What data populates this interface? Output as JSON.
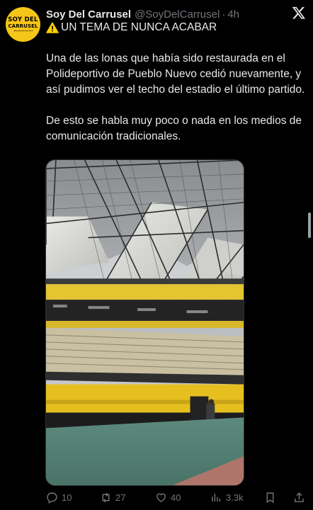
{
  "tweet": {
    "author_name": "Soy Del Carrusel",
    "author_handle": "@SoyDelCarrusel",
    "separator": "·",
    "time": "4h",
    "avatar_text_line1": "SOY DEL",
    "avatar_text_line2": "CARRUSEL",
    "title": "UN TEMA DE NUNCA ACABAR",
    "paragraphs": [
      "Una de las lonas que había sido restaurada en el Polideportivo de Pueblo Nuevo cedió nuevamente, y así pudimos ver el techo del estadio el último partido.",
      "De esto se habla muy poco o nada en los medios de comunicación tradicionales."
    ],
    "icons": {
      "warning": "warning-icon",
      "x_logo": "x-logo-icon",
      "reply": "reply-icon",
      "repost": "repost-icon",
      "like": "like-icon",
      "views": "views-icon",
      "bookmark": "bookmark-icon",
      "share": "share-icon"
    },
    "colors": {
      "background": "#000000",
      "text": "#e7e9ea",
      "muted": "#71767b",
      "warning": "#ffd000"
    },
    "stats": {
      "replies": "10",
      "reposts": "27",
      "likes": "40",
      "views": "3.3k"
    }
  }
}
